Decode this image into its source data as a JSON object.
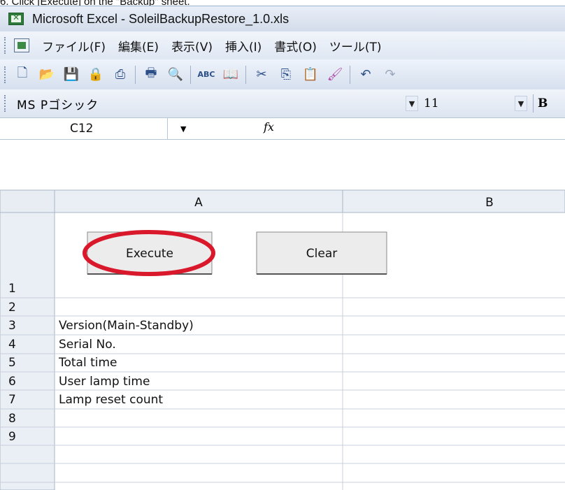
{
  "caption": "6.  Click [Execute] on the \"Backup\" sheet.",
  "window": {
    "title": "Microsoft Excel - SoleilBackupRestore_1.0.xls"
  },
  "menu": {
    "items": [
      "ファイル(F)",
      "編集(E)",
      "表示(V)",
      "挿入(I)",
      "書式(O)",
      "ツール(T)"
    ]
  },
  "toolbar": {
    "icons": [
      "new-icon",
      "open-icon",
      "save-icon",
      "permission-icon",
      "print-preview-icon",
      "print-icon",
      "preview-icon",
      "spelling-icon",
      "research-icon",
      "cut-icon",
      "copy-icon",
      "paste-icon",
      "format-painter-icon",
      "undo-icon",
      "redo-icon"
    ]
  },
  "format": {
    "font_name": "MS Pゴシック",
    "font_size": "11",
    "bold_label": "B"
  },
  "formula": {
    "cell_ref": "C12",
    "fx_label": "fx",
    "value": ""
  },
  "sheet": {
    "columns": [
      "A",
      "B"
    ],
    "rows": [
      {
        "num": "1",
        "a": ""
      },
      {
        "num": "2",
        "a": ""
      },
      {
        "num": "3",
        "a": "Version(Main-Standby)"
      },
      {
        "num": "4",
        "a": "Serial No."
      },
      {
        "num": "5",
        "a": "Total time"
      },
      {
        "num": "6",
        "a": "User lamp time"
      },
      {
        "num": "7",
        "a": "Lamp reset count"
      },
      {
        "num": "8",
        "a": ""
      },
      {
        "num": "9",
        "a": ""
      }
    ],
    "buttons": {
      "execute": "Execute",
      "clear": "Clear"
    }
  },
  "colors": {
    "highlight_ellipse": "#d9192b",
    "header_bg": "#e3e8f0",
    "grid_line": "#c8d0dc"
  }
}
